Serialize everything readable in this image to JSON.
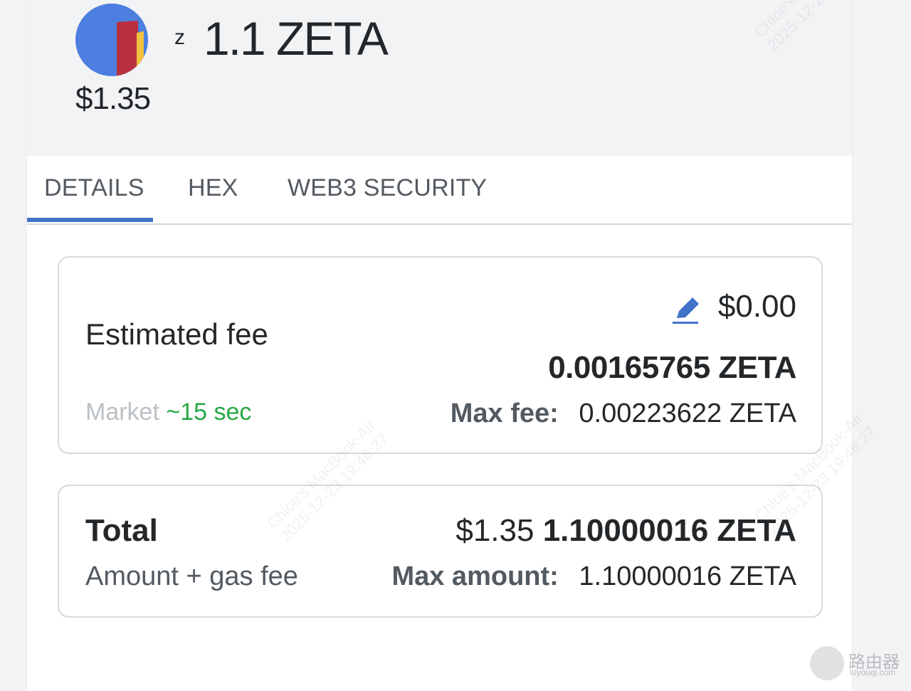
{
  "token": {
    "symbol_letter": "z",
    "amount": "1.1 ZETA",
    "fiat": "$1.35"
  },
  "tabs": [
    {
      "label": "DETAILS",
      "active": true
    },
    {
      "label": "HEX",
      "active": false
    },
    {
      "label": "WEB3 SECURITY",
      "active": false
    }
  ],
  "fee": {
    "label": "Estimated fee",
    "usd": "$0.00",
    "native": "0.00165765 ZETA",
    "speed_label": "Market",
    "speed_time": "~15 sec",
    "max_label": "Max fee:",
    "max_value": "0.00223622 ZETA",
    "edit_icon": "pencil-icon"
  },
  "total": {
    "label": "Total",
    "sub": "Amount + gas fee",
    "usd": "$1.35",
    "native": "1.10000016 ZETA",
    "max_label": "Max amount:",
    "max_value": "1.10000016 ZETA"
  },
  "colors": {
    "accent": "#4272c8",
    "success": "#28a745",
    "muted": "#bbc0c5"
  },
  "watermark": {
    "line1": "Chloe's MacBook-Air",
    "line2": "2025-12-23 19:46:27"
  },
  "corner_brand": {
    "name": "路由器",
    "domain": "luyouqi.com"
  }
}
